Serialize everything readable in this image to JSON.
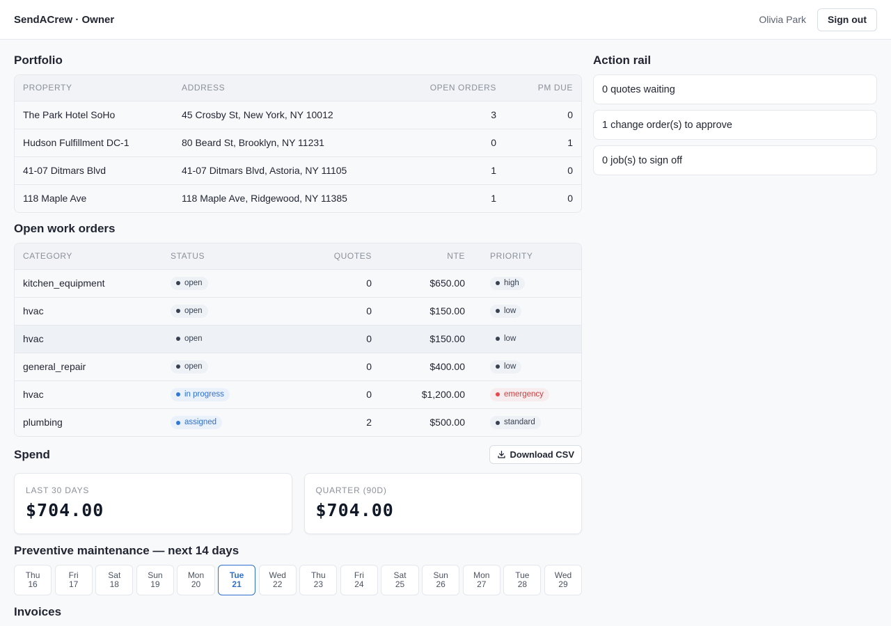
{
  "header": {
    "brand": "SendACrew · Owner",
    "user_name": "Olivia Park",
    "sign_out_label": "Sign out"
  },
  "portfolio": {
    "title": "Portfolio",
    "columns": [
      "PROPERTY",
      "ADDRESS",
      "OPEN ORDERS",
      "PM DUE"
    ],
    "rows": [
      {
        "property": "The Park Hotel SoHo",
        "address": "45 Crosby St, New York, NY 10012",
        "open_orders": "3",
        "pm_due": "0"
      },
      {
        "property": "Hudson Fulfillment DC-1",
        "address": "80 Beard St, Brooklyn, NY 11231",
        "open_orders": "0",
        "pm_due": "1"
      },
      {
        "property": "41-07 Ditmars Blvd",
        "address": "41-07 Ditmars Blvd, Astoria, NY 11105",
        "open_orders": "1",
        "pm_due": "0"
      },
      {
        "property": "118 Maple Ave",
        "address": "118 Maple Ave, Ridgewood, NY 11385",
        "open_orders": "1",
        "pm_due": "0"
      }
    ]
  },
  "work_orders": {
    "title": "Open work orders",
    "columns": [
      "CATEGORY",
      "STATUS",
      "QUOTES",
      "NTE",
      "PRIORITY"
    ],
    "rows": [
      {
        "category": "kitchen_equipment",
        "status": "open",
        "quotes": "0",
        "nte": "$650.00",
        "priority": "high"
      },
      {
        "category": "hvac",
        "status": "open",
        "quotes": "0",
        "nte": "$150.00",
        "priority": "low"
      },
      {
        "category": "hvac",
        "status": "open",
        "quotes": "0",
        "nte": "$150.00",
        "priority": "low"
      },
      {
        "category": "general_repair",
        "status": "open",
        "quotes": "0",
        "nte": "$400.00",
        "priority": "low"
      },
      {
        "category": "hvac",
        "status": "in progress",
        "quotes": "0",
        "nte": "$1,200.00",
        "priority": "emergency"
      },
      {
        "category": "plumbing",
        "status": "assigned",
        "quotes": "2",
        "nte": "$500.00",
        "priority": "standard"
      }
    ]
  },
  "spend": {
    "title": "Spend",
    "download_label": "Download CSV",
    "cards": [
      {
        "label": "LAST 30 DAYS",
        "value": "$704.00"
      },
      {
        "label": "QUARTER (90D)",
        "value": "$704.00"
      }
    ]
  },
  "pm": {
    "title": "Preventive maintenance — next 14 days",
    "days": [
      {
        "dow": "Thu",
        "date": "16"
      },
      {
        "dow": "Fri",
        "date": "17"
      },
      {
        "dow": "Sat",
        "date": "18"
      },
      {
        "dow": "Sun",
        "date": "19"
      },
      {
        "dow": "Mon",
        "date": "20"
      },
      {
        "dow": "Tue",
        "date": "21"
      },
      {
        "dow": "Wed",
        "date": "22"
      },
      {
        "dow": "Thu",
        "date": "23"
      },
      {
        "dow": "Fri",
        "date": "24"
      },
      {
        "dow": "Sat",
        "date": "25"
      },
      {
        "dow": "Sun",
        "date": "26"
      },
      {
        "dow": "Mon",
        "date": "27"
      },
      {
        "dow": "Tue",
        "date": "28"
      },
      {
        "dow": "Wed",
        "date": "29"
      }
    ],
    "selected_date": "21"
  },
  "invoices": {
    "title": "Invoices"
  },
  "action_rail": {
    "title": "Action rail",
    "items": [
      "0 quotes waiting",
      "1 change order(s) to approve",
      "0 job(s) to sign off"
    ]
  },
  "colors": {
    "accent": "#2f6fcf",
    "emergency": "#e5484d",
    "neutral_dot": "#374151"
  },
  "icons": {
    "download": "download-icon"
  }
}
